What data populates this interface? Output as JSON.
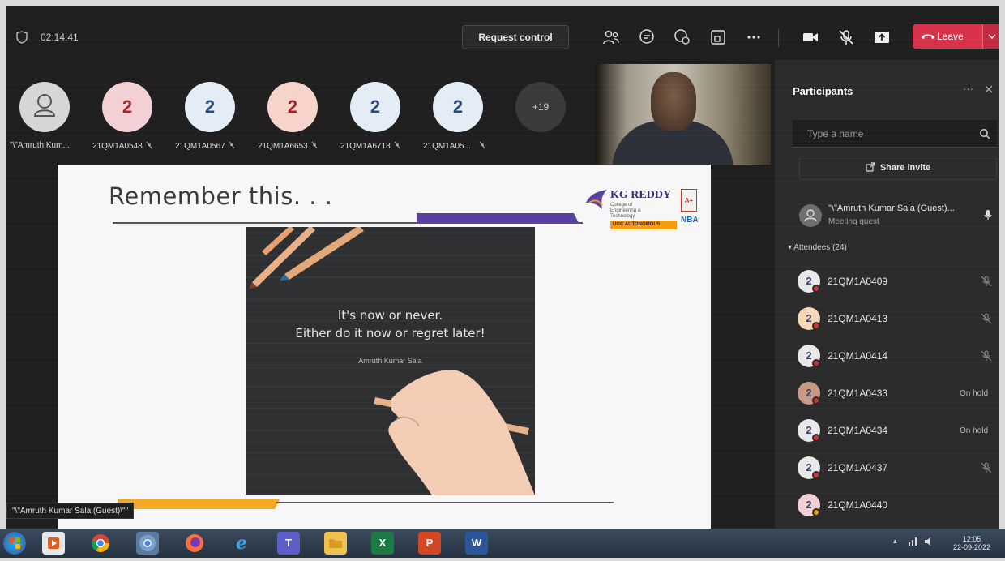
{
  "meeting": {
    "timer": "02:14:41",
    "request_control_label": "Request control",
    "leave_label": "Leave"
  },
  "strip": {
    "avatars": [
      {
        "initial": "",
        "name": "\"\\\"Amruth Kum...",
        "bg": "#d6d6d6"
      },
      {
        "initial": "2",
        "name": "21QM1A0548",
        "bg": "#f3d0d4",
        "fg": "#a4262c"
      },
      {
        "initial": "2",
        "name": "21QM1A0567",
        "bg": "#e4ecf6",
        "fg": "#2a4a7a"
      },
      {
        "initial": "2",
        "name": "21QM1A6653",
        "bg": "#f6d4cc",
        "fg": "#a4262c"
      },
      {
        "initial": "2",
        "name": "21QM1A6718",
        "bg": "#e4ecf6",
        "fg": "#2a4a7a"
      },
      {
        "initial": "2",
        "name": "21QM1A05...",
        "bg": "#e4ecf6",
        "fg": "#2a4a7a"
      }
    ],
    "overflow_count": "+19"
  },
  "slide": {
    "title": "Remember this. . .",
    "logo_name": "KG REDDY",
    "logo_sub": "College of Engineering & Technology",
    "logo_badge": "UGC AUTONOMOUS",
    "logo_naac": "A+",
    "logo_nba": "NBA",
    "quote_line1": "It's now or never.",
    "quote_line2": "Either do it now or regret later!",
    "quote_author": "Amruth Kumar Sala"
  },
  "presenter_tag": "\"\\\"Amruth Kumar Sala (Guest)\\\"\"",
  "panel": {
    "title": "Participants",
    "more": "···",
    "search_placeholder": "Type a name",
    "share_invite": "Share invite",
    "guest": {
      "name": "\"\\\"Amruth Kumar Sala (Guest)...",
      "role": "Meeting guest"
    },
    "attendees_label": "Attendees (24)",
    "attendees": [
      {
        "initial": "2",
        "name": "21QM1A0409",
        "status": ""
      },
      {
        "initial": "2",
        "name": "21QM1A0413",
        "status": ""
      },
      {
        "initial": "2",
        "name": "21QM1A0414",
        "status": ""
      },
      {
        "initial": "2",
        "name": "21QM1A0433",
        "status": "On hold"
      },
      {
        "initial": "2",
        "name": "21QM1A0434",
        "status": "On hold"
      },
      {
        "initial": "2",
        "name": "21QM1A0437",
        "status": ""
      },
      {
        "initial": "2",
        "name": "21QM1A0440",
        "status": ""
      }
    ]
  },
  "taskbar": {
    "clock_time": "12:05",
    "clock_date": "22-09-2022"
  },
  "colors": {
    "leave": "#d8324b",
    "accent_purple": "#5a3fa0",
    "accent_orange": "#f5a623"
  }
}
